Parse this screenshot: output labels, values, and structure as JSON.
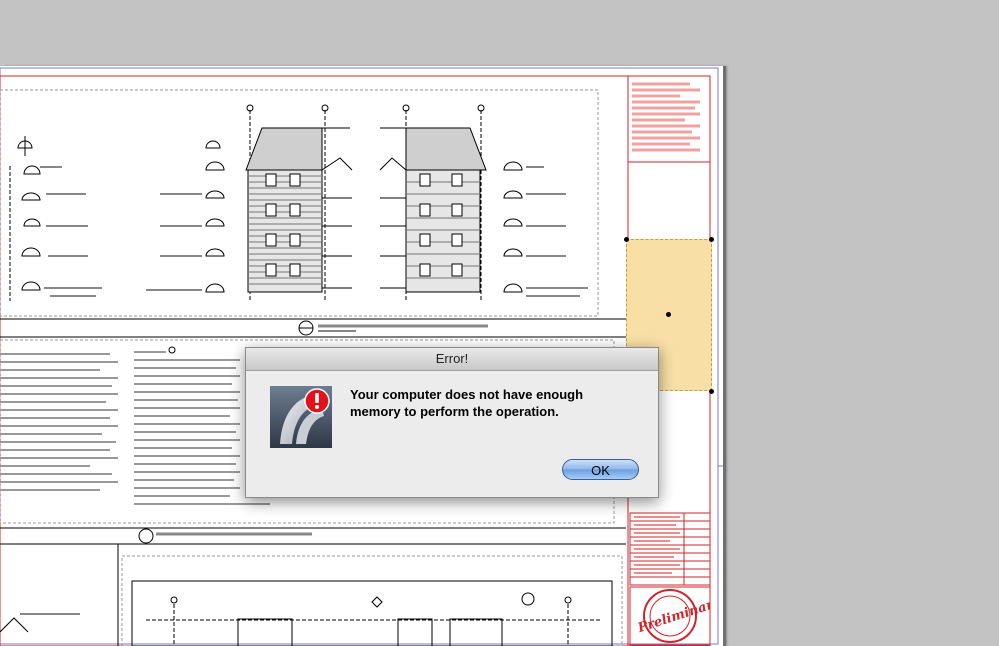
{
  "dialog": {
    "title": "Error!",
    "message": "Your computer does not have enough\nmemory to perform the operation.",
    "ok_label": "OK",
    "icon": "app-error-icon"
  },
  "drawing": {
    "stamp_text": "Preliminary"
  },
  "colors": {
    "desktop": "#c3c3c3",
    "sheet_border": "#d0252a",
    "selection_fill": "#f8dfa6",
    "dialog_bg": "#ececec",
    "ok_button": "#8fb8ea"
  }
}
